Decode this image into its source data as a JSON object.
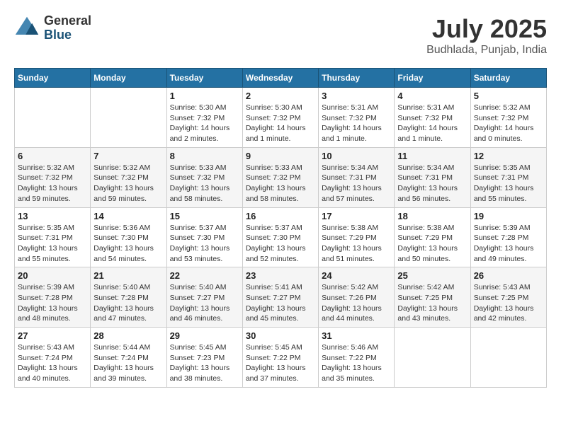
{
  "header": {
    "logo_general": "General",
    "logo_blue": "Blue",
    "month_title": "July 2025",
    "location": "Budhlada, Punjab, India"
  },
  "weekdays": [
    "Sunday",
    "Monday",
    "Tuesday",
    "Wednesday",
    "Thursday",
    "Friday",
    "Saturday"
  ],
  "weeks": [
    [
      {
        "day": "",
        "info": ""
      },
      {
        "day": "",
        "info": ""
      },
      {
        "day": "1",
        "info": "Sunrise: 5:30 AM\nSunset: 7:32 PM\nDaylight: 14 hours\nand 2 minutes."
      },
      {
        "day": "2",
        "info": "Sunrise: 5:30 AM\nSunset: 7:32 PM\nDaylight: 14 hours\nand 1 minute."
      },
      {
        "day": "3",
        "info": "Sunrise: 5:31 AM\nSunset: 7:32 PM\nDaylight: 14 hours\nand 1 minute."
      },
      {
        "day": "4",
        "info": "Sunrise: 5:31 AM\nSunset: 7:32 PM\nDaylight: 14 hours\nand 1 minute."
      },
      {
        "day": "5",
        "info": "Sunrise: 5:32 AM\nSunset: 7:32 PM\nDaylight: 14 hours\nand 0 minutes."
      }
    ],
    [
      {
        "day": "6",
        "info": "Sunrise: 5:32 AM\nSunset: 7:32 PM\nDaylight: 13 hours\nand 59 minutes."
      },
      {
        "day": "7",
        "info": "Sunrise: 5:32 AM\nSunset: 7:32 PM\nDaylight: 13 hours\nand 59 minutes."
      },
      {
        "day": "8",
        "info": "Sunrise: 5:33 AM\nSunset: 7:32 PM\nDaylight: 13 hours\nand 58 minutes."
      },
      {
        "day": "9",
        "info": "Sunrise: 5:33 AM\nSunset: 7:32 PM\nDaylight: 13 hours\nand 58 minutes."
      },
      {
        "day": "10",
        "info": "Sunrise: 5:34 AM\nSunset: 7:31 PM\nDaylight: 13 hours\nand 57 minutes."
      },
      {
        "day": "11",
        "info": "Sunrise: 5:34 AM\nSunset: 7:31 PM\nDaylight: 13 hours\nand 56 minutes."
      },
      {
        "day": "12",
        "info": "Sunrise: 5:35 AM\nSunset: 7:31 PM\nDaylight: 13 hours\nand 55 minutes."
      }
    ],
    [
      {
        "day": "13",
        "info": "Sunrise: 5:35 AM\nSunset: 7:31 PM\nDaylight: 13 hours\nand 55 minutes."
      },
      {
        "day": "14",
        "info": "Sunrise: 5:36 AM\nSunset: 7:30 PM\nDaylight: 13 hours\nand 54 minutes."
      },
      {
        "day": "15",
        "info": "Sunrise: 5:37 AM\nSunset: 7:30 PM\nDaylight: 13 hours\nand 53 minutes."
      },
      {
        "day": "16",
        "info": "Sunrise: 5:37 AM\nSunset: 7:30 PM\nDaylight: 13 hours\nand 52 minutes."
      },
      {
        "day": "17",
        "info": "Sunrise: 5:38 AM\nSunset: 7:29 PM\nDaylight: 13 hours\nand 51 minutes."
      },
      {
        "day": "18",
        "info": "Sunrise: 5:38 AM\nSunset: 7:29 PM\nDaylight: 13 hours\nand 50 minutes."
      },
      {
        "day": "19",
        "info": "Sunrise: 5:39 AM\nSunset: 7:28 PM\nDaylight: 13 hours\nand 49 minutes."
      }
    ],
    [
      {
        "day": "20",
        "info": "Sunrise: 5:39 AM\nSunset: 7:28 PM\nDaylight: 13 hours\nand 48 minutes."
      },
      {
        "day": "21",
        "info": "Sunrise: 5:40 AM\nSunset: 7:28 PM\nDaylight: 13 hours\nand 47 minutes."
      },
      {
        "day": "22",
        "info": "Sunrise: 5:40 AM\nSunset: 7:27 PM\nDaylight: 13 hours\nand 46 minutes."
      },
      {
        "day": "23",
        "info": "Sunrise: 5:41 AM\nSunset: 7:27 PM\nDaylight: 13 hours\nand 45 minutes."
      },
      {
        "day": "24",
        "info": "Sunrise: 5:42 AM\nSunset: 7:26 PM\nDaylight: 13 hours\nand 44 minutes."
      },
      {
        "day": "25",
        "info": "Sunrise: 5:42 AM\nSunset: 7:25 PM\nDaylight: 13 hours\nand 43 minutes."
      },
      {
        "day": "26",
        "info": "Sunrise: 5:43 AM\nSunset: 7:25 PM\nDaylight: 13 hours\nand 42 minutes."
      }
    ],
    [
      {
        "day": "27",
        "info": "Sunrise: 5:43 AM\nSunset: 7:24 PM\nDaylight: 13 hours\nand 40 minutes."
      },
      {
        "day": "28",
        "info": "Sunrise: 5:44 AM\nSunset: 7:24 PM\nDaylight: 13 hours\nand 39 minutes."
      },
      {
        "day": "29",
        "info": "Sunrise: 5:45 AM\nSunset: 7:23 PM\nDaylight: 13 hours\nand 38 minutes."
      },
      {
        "day": "30",
        "info": "Sunrise: 5:45 AM\nSunset: 7:22 PM\nDaylight: 13 hours\nand 37 minutes."
      },
      {
        "day": "31",
        "info": "Sunrise: 5:46 AM\nSunset: 7:22 PM\nDaylight: 13 hours\nand 35 minutes."
      },
      {
        "day": "",
        "info": ""
      },
      {
        "day": "",
        "info": ""
      }
    ]
  ]
}
